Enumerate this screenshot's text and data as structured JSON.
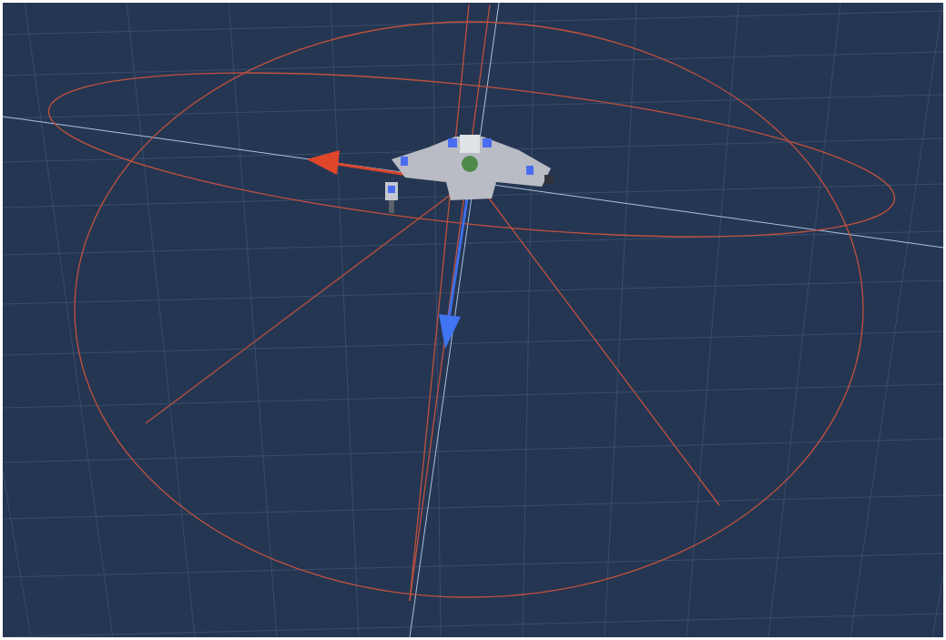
{
  "viewport": {
    "kind": "scene3d"
  }
}
